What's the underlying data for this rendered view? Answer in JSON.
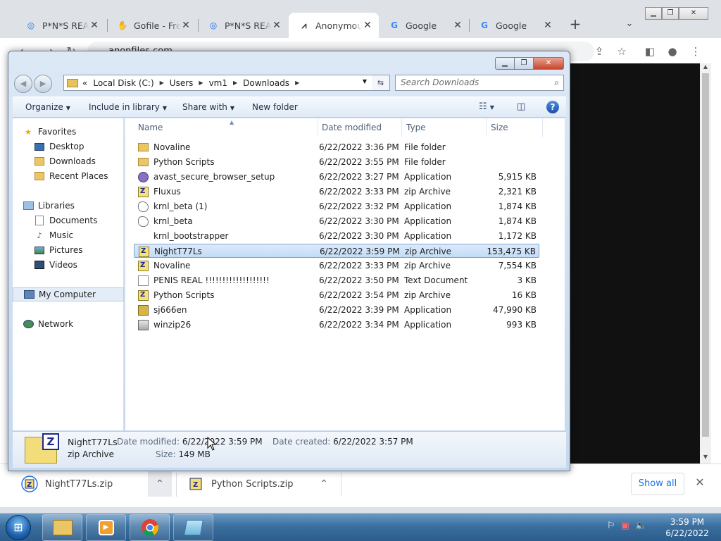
{
  "browser": {
    "tabs": [
      {
        "title": "P*N*S REAL",
        "close": "✕"
      },
      {
        "title": "Gofile - Free",
        "close": "✕"
      },
      {
        "title": "P*N*S REAL",
        "close": "✕"
      },
      {
        "title": "Anonymous",
        "close": "✕"
      },
      {
        "title": "Google",
        "close": "✕"
      },
      {
        "title": "Google",
        "close": "✕"
      }
    ],
    "url": "anonfiles.com",
    "downloads": [
      {
        "name": "NightT77Ls.zip",
        "caret": "⌃"
      },
      {
        "name": "Python Scripts.zip",
        "caret": "⌃"
      }
    ],
    "show_all": "Show all",
    "download_bar_close": "✕"
  },
  "explorer": {
    "breadcrumb_prefix": "«",
    "breadcrumb": [
      "Local Disk (C:)",
      "Users",
      "vm1",
      "Downloads"
    ],
    "search_placeholder": "Search Downloads",
    "commands": [
      "Organize",
      "Include in library",
      "Share with",
      "New folder"
    ],
    "nav": {
      "favorites_header": "Favorites",
      "favorites": [
        "Desktop",
        "Downloads",
        "Recent Places"
      ],
      "libraries_header": "Libraries",
      "libraries": [
        "Documents",
        "Music",
        "Pictures",
        "Videos"
      ],
      "computer": "My Computer",
      "network": "Network"
    },
    "columns": {
      "name": "Name",
      "date": "Date modified",
      "type": "Type",
      "size": "Size"
    },
    "files": [
      {
        "name": "Novaline",
        "date": "6/22/2022 3:36 PM",
        "type": "File folder",
        "size": "",
        "icon": "folder"
      },
      {
        "name": "Python Scripts",
        "date": "6/22/2022 3:55 PM",
        "type": "File folder",
        "size": "",
        "icon": "folder"
      },
      {
        "name": "avast_secure_browser_setup",
        "date": "6/22/2022 3:27 PM",
        "type": "Application",
        "size": "5,915 KB",
        "icon": "app"
      },
      {
        "name": "Fluxus",
        "date": "6/22/2022 3:33 PM",
        "type": "zip Archive",
        "size": "2,321 KB",
        "icon": "zip"
      },
      {
        "name": "krnl_beta (1)",
        "date": "6/22/2022 3:32 PM",
        "type": "Application",
        "size": "1,874 KB",
        "icon": "krnl"
      },
      {
        "name": "krnl_beta",
        "date": "6/22/2022 3:30 PM",
        "type": "Application",
        "size": "1,874 KB",
        "icon": "krnl"
      },
      {
        "name": "krnl_bootstrapper",
        "date": "6/22/2022 3:30 PM",
        "type": "Application",
        "size": "1,172 KB",
        "icon": "blank"
      },
      {
        "name": "NightT77Ls",
        "date": "6/22/2022 3:59 PM",
        "type": "zip Archive",
        "size": "153,475 KB",
        "icon": "zip",
        "selected": true
      },
      {
        "name": "Novaline",
        "date": "6/22/2022 3:33 PM",
        "type": "zip Archive",
        "size": "7,554 KB",
        "icon": "zip"
      },
      {
        "name": "PENIS REAL !!!!!!!!!!!!!!!!!!!",
        "date": "6/22/2022 3:50 PM",
        "type": "Text Document",
        "size": "3 KB",
        "icon": "txt"
      },
      {
        "name": "Python Scripts",
        "date": "6/22/2022 3:54 PM",
        "type": "zip Archive",
        "size": "16 KB",
        "icon": "zip"
      },
      {
        "name": "sj666en",
        "date": "6/22/2022 3:39 PM",
        "type": "Application",
        "size": "47,990 KB",
        "icon": "sj"
      },
      {
        "name": "winzip26",
        "date": "6/22/2022 3:34 PM",
        "type": "Application",
        "size": "993 KB",
        "icon": "wz"
      }
    ],
    "details": {
      "name": "NightT77Ls",
      "type": "zip Archive",
      "modified_label": "Date modified:",
      "modified": "6/22/2022 3:59 PM",
      "created_label": "Date created:",
      "created": "6/22/2022 3:57 PM",
      "size_label": "Size:",
      "size": "149 MB"
    }
  },
  "taskbar": {
    "time": "3:59 PM",
    "date": "6/22/2022"
  }
}
